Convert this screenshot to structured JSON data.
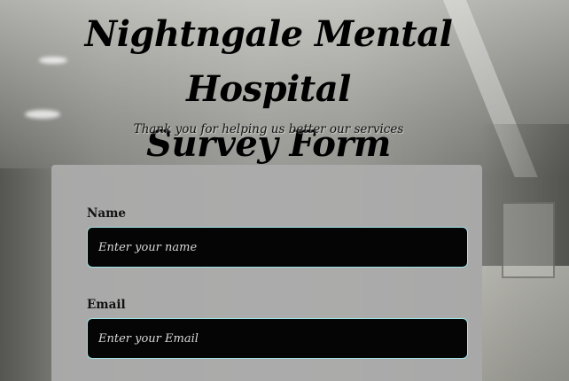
{
  "header": {
    "title_line1": "Nightngale Mental Hospital",
    "title_line2": "Survey Form",
    "subtitle": "Thank you for helping us better our services"
  },
  "form": {
    "fields": [
      {
        "label": "Name",
        "value": "",
        "placeholder": "Enter your name"
      },
      {
        "label": "Email",
        "value": "",
        "placeholder": "Enter your Email"
      }
    ]
  },
  "colors": {
    "input_background": "#050505",
    "input_border": "#9fe3e6",
    "card_background": "#acacac"
  }
}
